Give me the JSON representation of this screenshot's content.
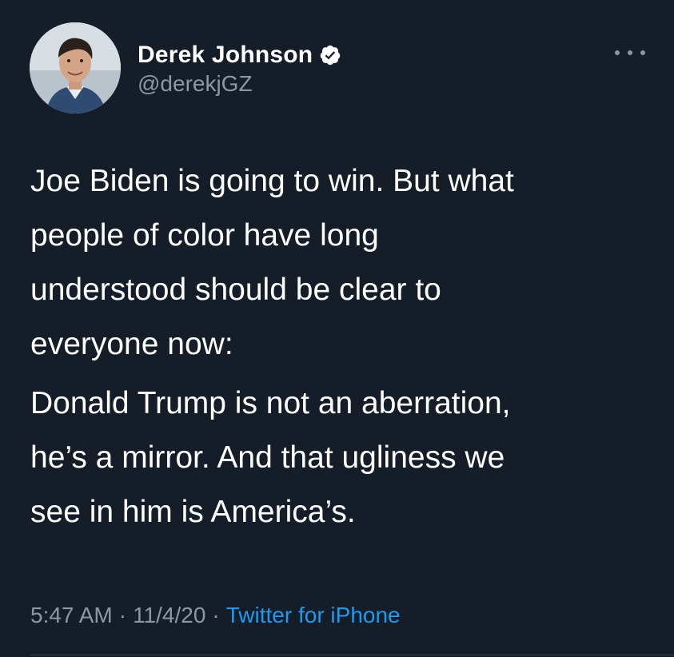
{
  "tweet": {
    "author": {
      "name": "Derek Johnson",
      "handle": "@derekjGZ",
      "verified_icon": "verified-badge-icon",
      "avatar_icon": "avatar-photo"
    },
    "more_icon": "more-options-icon",
    "text": {
      "paragraph1": [
        "Joe Biden is going to win. But what",
        "people of color have long",
        "understood should be clear to",
        "everyone now:"
      ],
      "paragraph2": [
        "Donald Trump is not an aberration,",
        "he’s a mirror. And that ugliness we",
        "see in him is America’s."
      ]
    },
    "meta": {
      "time": "5:47 AM",
      "separator": "·",
      "date": "11/4/20",
      "source": "Twitter for iPhone"
    },
    "colors": {
      "background": "#151d28",
      "text_primary": "#ffffff",
      "text_secondary": "#8b98a5",
      "link": "#1d9bf0",
      "verified": "#ffffff"
    }
  }
}
